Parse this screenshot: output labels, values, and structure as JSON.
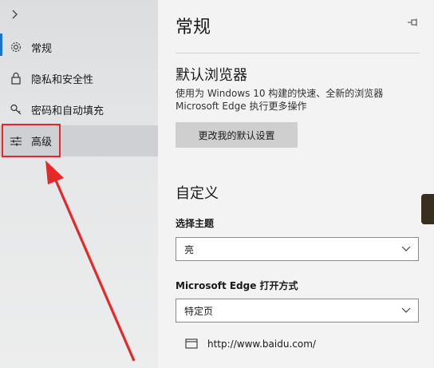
{
  "sidebar": {
    "items": [
      {
        "label": "常规",
        "icon": "gear-icon"
      },
      {
        "label": "隐私和安全性",
        "icon": "lock-icon"
      },
      {
        "label": "密码和自动填充",
        "icon": "key-icon"
      },
      {
        "label": "高级",
        "icon": "sliders-icon"
      }
    ]
  },
  "main": {
    "title": "常规",
    "default_browser": {
      "heading": "默认浏览器",
      "desc_line1": "使用为 Windows 10 构建的快速、全新的浏览器",
      "desc_line2": "Microsoft Edge 执行更多操作",
      "button": "更改我的默认设置"
    },
    "customize": {
      "heading": "自定义",
      "theme_label": "选择主题",
      "theme_value": "亮",
      "open_label": "Microsoft Edge 打开方式",
      "open_value": "特定页",
      "url": "http://www.baidu.com/"
    }
  },
  "colors": {
    "accent": "#1a73c6",
    "annotation": "#e62828"
  }
}
